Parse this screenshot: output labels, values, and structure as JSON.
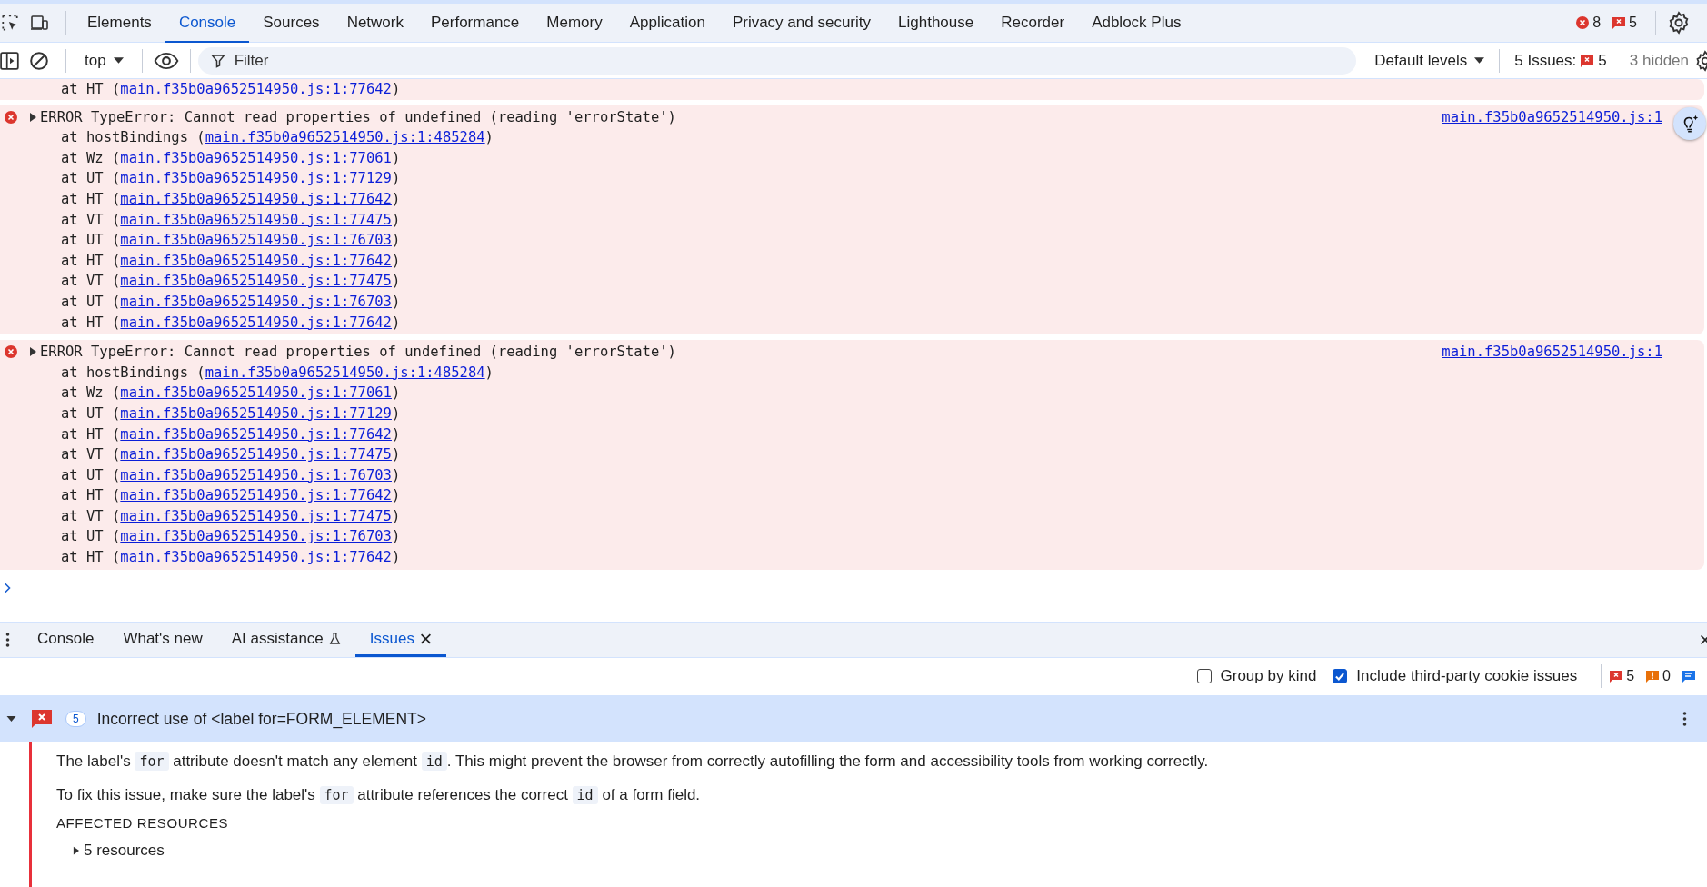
{
  "main_tabs": [
    {
      "label": "Elements",
      "selected": false
    },
    {
      "label": "Console",
      "selected": true
    },
    {
      "label": "Sources",
      "selected": false
    },
    {
      "label": "Network",
      "selected": false
    },
    {
      "label": "Performance",
      "selected": false
    },
    {
      "label": "Memory",
      "selected": false
    },
    {
      "label": "Application",
      "selected": false
    },
    {
      "label": "Privacy and security",
      "selected": false
    },
    {
      "label": "Lighthouse",
      "selected": false
    },
    {
      "label": "Recorder",
      "selected": false
    },
    {
      "label": "Adblock Plus",
      "selected": false
    }
  ],
  "top_counts": [
    {
      "kind": "error",
      "count": "8"
    },
    {
      "kind": "issue",
      "count": "5"
    }
  ],
  "console_toolbar": {
    "context": "top",
    "filter_placeholder": "Filter",
    "levels": "Default levels",
    "issues_label": "5 Issues:",
    "issues_count": "5",
    "hidden": "3 hidden"
  },
  "messages": [
    {
      "kind": "continuation",
      "stack": [
        {
          "frame": "at HT (",
          "link": "main.f35b0a9652514950.js:1:77642",
          "end": ")"
        }
      ]
    },
    {
      "kind": "error",
      "expanded": false,
      "text": "ERROR TypeError: Cannot read properties of undefined (reading 'errorState')",
      "source": "main.f35b0a9652514950.js:1",
      "stack": [
        {
          "frame": "at hostBindings (",
          "link": "main.f35b0a9652514950.js:1:485284",
          "end": ")"
        },
        {
          "frame": "at Wz (",
          "link": "main.f35b0a9652514950.js:1:77061",
          "end": ")"
        },
        {
          "frame": "at UT (",
          "link": "main.f35b0a9652514950.js:1:77129",
          "end": ")"
        },
        {
          "frame": "at HT (",
          "link": "main.f35b0a9652514950.js:1:77642",
          "end": ")"
        },
        {
          "frame": "at VT (",
          "link": "main.f35b0a9652514950.js:1:77475",
          "end": ")"
        },
        {
          "frame": "at UT (",
          "link": "main.f35b0a9652514950.js:1:76703",
          "end": ")"
        },
        {
          "frame": "at HT (",
          "link": "main.f35b0a9652514950.js:1:77642",
          "end": ")"
        },
        {
          "frame": "at VT (",
          "link": "main.f35b0a9652514950.js:1:77475",
          "end": ")"
        },
        {
          "frame": "at UT (",
          "link": "main.f35b0a9652514950.js:1:76703",
          "end": ")"
        },
        {
          "frame": "at HT (",
          "link": "main.f35b0a9652514950.js:1:77642",
          "end": ")"
        }
      ]
    },
    {
      "kind": "error",
      "expanded": false,
      "text": "ERROR TypeError: Cannot read properties of undefined (reading 'errorState')",
      "source": "main.f35b0a9652514950.js:1",
      "stack": [
        {
          "frame": "at hostBindings (",
          "link": "main.f35b0a9652514950.js:1:485284",
          "end": ")"
        },
        {
          "frame": "at Wz (",
          "link": "main.f35b0a9652514950.js:1:77061",
          "end": ")"
        },
        {
          "frame": "at UT (",
          "link": "main.f35b0a9652514950.js:1:77129",
          "end": ")"
        },
        {
          "frame": "at HT (",
          "link": "main.f35b0a9652514950.js:1:77642",
          "end": ")"
        },
        {
          "frame": "at VT (",
          "link": "main.f35b0a9652514950.js:1:77475",
          "end": ")"
        },
        {
          "frame": "at UT (",
          "link": "main.f35b0a9652514950.js:1:76703",
          "end": ")"
        },
        {
          "frame": "at HT (",
          "link": "main.f35b0a9652514950.js:1:77642",
          "end": ")"
        },
        {
          "frame": "at VT (",
          "link": "main.f35b0a9652514950.js:1:77475",
          "end": ")"
        },
        {
          "frame": "at UT (",
          "link": "main.f35b0a9652514950.js:1:76703",
          "end": ")"
        },
        {
          "frame": "at HT (",
          "link": "main.f35b0a9652514950.js:1:77642",
          "end": ")"
        }
      ]
    }
  ],
  "drawer_tabs": [
    {
      "label": "Console",
      "kind": "plain",
      "selected": false
    },
    {
      "label": "What's new",
      "kind": "plain",
      "selected": false
    },
    {
      "label": "AI assistance",
      "kind": "experiment",
      "selected": false
    },
    {
      "label": "Issues",
      "kind": "closable",
      "selected": true
    }
  ],
  "issue_options": [
    {
      "label": "Group by kind",
      "checked": false
    },
    {
      "label": "Include third-party cookie issues",
      "checked": true
    }
  ],
  "issue_counts": [
    {
      "kind": "error",
      "count": "5"
    },
    {
      "kind": "warning",
      "count": "0"
    },
    {
      "kind": "info"
    }
  ],
  "issue": {
    "count": "5",
    "title": "Incorrect use of <label for=FORM_ELEMENT>",
    "expanded": true,
    "paragraphs": [
      [
        {
          "text": "The label's ",
          "kind": "text"
        },
        {
          "text": "for",
          "kind": "code"
        },
        {
          "text": " attribute doesn't match any element ",
          "kind": "text"
        },
        {
          "text": "id",
          "kind": "code"
        },
        {
          "text": ". This might prevent the browser from correctly autofilling the form and accessibility tools from working correctly.",
          "kind": "text"
        }
      ],
      [
        {
          "text": "To fix this issue, make sure the label's ",
          "kind": "text"
        },
        {
          "text": "for",
          "kind": "code"
        },
        {
          "text": " attribute references the correct ",
          "kind": "text"
        },
        {
          "text": "id",
          "kind": "code"
        },
        {
          "text": " of a form field.",
          "kind": "text"
        }
      ]
    ],
    "affected_heading": "AFFECTED RESOURCES",
    "resources": {
      "label": "5 resources",
      "expanded": false
    }
  }
}
